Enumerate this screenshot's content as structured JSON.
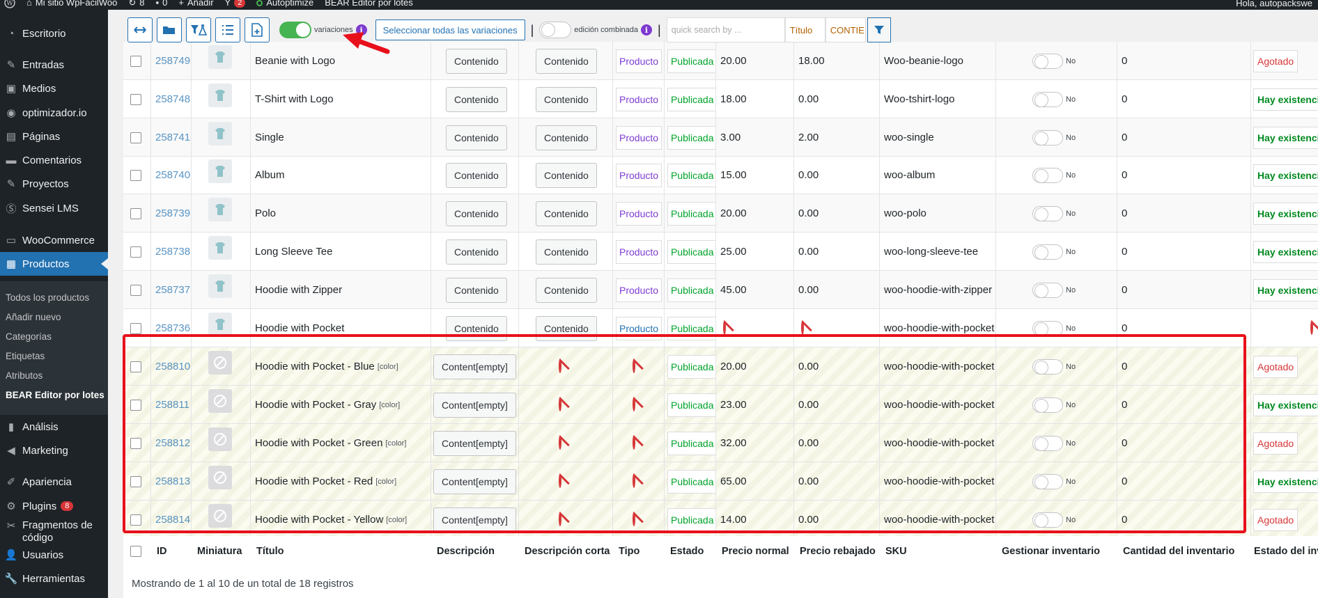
{
  "adminbar": {
    "site_name": "Mi sitio WpFácilWoo",
    "updates": "8",
    "comments": "0",
    "new_label": "Añadir",
    "yoast_badge": "2",
    "autoptimize": "Autoptimize",
    "bear": "BEAR Editor por lotes",
    "greeting": "Hola, autopackswe"
  },
  "sidebar": {
    "items": [
      {
        "label": "Escritorio",
        "icon": "dashboard-icon"
      },
      {
        "label": "Entradas",
        "icon": "pin-icon"
      },
      {
        "label": "Medios",
        "icon": "media-icon"
      },
      {
        "label": "optimizador.io",
        "icon": "optimizer-icon"
      },
      {
        "label": "Páginas",
        "icon": "pages-icon"
      },
      {
        "label": "Comentarios",
        "icon": "comment-icon"
      },
      {
        "label": "Proyectos",
        "icon": "pin-icon"
      },
      {
        "label": "Sensei LMS",
        "icon": "sensei-icon"
      },
      {
        "label": "WooCommerce",
        "icon": "woo-icon"
      },
      {
        "label": "Productos",
        "icon": "archive-icon"
      },
      {
        "label": "Análisis",
        "icon": "chart-icon"
      },
      {
        "label": "Marketing",
        "icon": "megaphone-icon"
      },
      {
        "label": "Apariencia",
        "icon": "brush-icon"
      },
      {
        "label": "Plugins",
        "icon": "plugin-icon",
        "badge": "8"
      },
      {
        "label": "Fragmentos de",
        "label2": "código",
        "icon": "scissors-icon"
      },
      {
        "label": "Usuarios",
        "icon": "users-icon"
      },
      {
        "label": "Herramientas",
        "icon": "wrench-icon"
      }
    ],
    "submenu": [
      "Todos los productos",
      "Añadir nuevo",
      "Categorías",
      "Etiquetas",
      "Atributos",
      "BEAR Editor por lotes"
    ]
  },
  "toolbar": {
    "variations_label": "variaciones",
    "select_all_variations": "Seleccionar todas las variaciones",
    "combined_edit_label": "edición combinada",
    "search_placeholder": "quick search by ...",
    "field_title": "Título",
    "field_content": "CONTIE"
  },
  "rows": [
    {
      "id": "258749",
      "title": "Beanie with Logo",
      "desc": "Contenido",
      "short": "Contenido",
      "type": "Producto",
      "status": "Publicada",
      "regular": "20.00",
      "sale": "18.00",
      "sku": "Woo-beanie-logo",
      "manage": "No",
      "qty": "0",
      "stock": "Agotado",
      "stock_class": "out"
    },
    {
      "id": "258748",
      "title": "T-Shirt with Logo",
      "desc": "Contenido",
      "short": "Contenido",
      "type": "Producto",
      "status": "Publicada",
      "regular": "18.00",
      "sale": "0.00",
      "sku": "Woo-tshirt-logo",
      "manage": "No",
      "qty": "0",
      "stock": "Hay existencias",
      "stock_class": "in"
    },
    {
      "id": "258741",
      "title": "Single",
      "desc": "Contenido",
      "short": "Contenido",
      "type": "Producto",
      "status": "Publicada",
      "regular": "3.00",
      "sale": "2.00",
      "sku": "woo-single",
      "manage": "No",
      "qty": "0",
      "stock": "Hay existencias",
      "stock_class": "in"
    },
    {
      "id": "258740",
      "title": "Album",
      "desc": "Contenido",
      "short": "Contenido",
      "type": "Producto",
      "status": "Publicada",
      "regular": "15.00",
      "sale": "0.00",
      "sku": "woo-album",
      "manage": "No",
      "qty": "0",
      "stock": "Hay existencias",
      "stock_class": "in"
    },
    {
      "id": "258739",
      "title": "Polo",
      "desc": "Contenido",
      "short": "Contenido",
      "type": "Producto",
      "status": "Publicada",
      "regular": "20.00",
      "sale": "0.00",
      "sku": "woo-polo",
      "manage": "No",
      "qty": "0",
      "stock": "Hay existencias",
      "stock_class": "in"
    },
    {
      "id": "258738",
      "title": "Long Sleeve Tee",
      "desc": "Contenido",
      "short": "Contenido",
      "type": "Producto",
      "status": "Publicada",
      "regular": "25.00",
      "sale": "0.00",
      "sku": "woo-long-sleeve-tee",
      "manage": "No",
      "qty": "0",
      "stock": "Hay existencias",
      "stock_class": "in"
    },
    {
      "id": "258737",
      "title": "Hoodie with Zipper",
      "desc": "Contenido",
      "short": "Contenido",
      "type": "Producto",
      "status": "Publicada",
      "regular": "45.00",
      "sale": "0.00",
      "sku": "woo-hoodie-with-zipper",
      "manage": "No",
      "qty": "0",
      "stock": "Hay existencias",
      "stock_class": "in"
    },
    {
      "id": "258736",
      "title": "Hoodie with Pocket",
      "desc": "Contenido",
      "short": "Contenido",
      "type": "Producto",
      "status": "Publicada",
      "regular": "",
      "sale": "",
      "sku": "woo-hoodie-with-pocket",
      "manage": "No",
      "qty": "0",
      "stock": "",
      "stock_class": "ban"
    }
  ],
  "variations": [
    {
      "id": "258810",
      "title": "Hoodie with Pocket - Blue",
      "tag": "[color]",
      "desc": "Content[empty]",
      "status": "Publicada",
      "regular": "20.00",
      "sale": "0.00",
      "sku": "woo-hoodie-with-pocket",
      "manage": "No",
      "qty": "0",
      "stock": "Agotado",
      "stock_class": "out"
    },
    {
      "id": "258811",
      "title": "Hoodie with Pocket - Gray",
      "tag": "[color]",
      "desc": "Content[empty]",
      "status": "Publicada",
      "regular": "23.00",
      "sale": "0.00",
      "sku": "woo-hoodie-with-pocket",
      "manage": "No",
      "qty": "0",
      "stock": "Hay existencias",
      "stock_class": "in"
    },
    {
      "id": "258812",
      "title": "Hoodie with Pocket - Green",
      "tag": "[color]",
      "desc": "Content[empty]",
      "status": "Publicada",
      "regular": "32.00",
      "sale": "0.00",
      "sku": "woo-hoodie-with-pocket",
      "manage": "No",
      "qty": "0",
      "stock": "Agotado",
      "stock_class": "out"
    },
    {
      "id": "258813",
      "title": "Hoodie with Pocket - Red",
      "tag": "[color]",
      "desc": "Content[empty]",
      "status": "Publicada",
      "regular": "65.00",
      "sale": "0.00",
      "sku": "woo-hoodie-with-pocket",
      "manage": "No",
      "qty": "0",
      "stock": "Hay existencias",
      "stock_class": "in"
    },
    {
      "id": "258814",
      "title": "Hoodie with Pocket - Yellow",
      "tag": "[color]",
      "desc": "Content[empty]",
      "status": "Publicada",
      "regular": "14.00",
      "sale": "0.00",
      "sku": "woo-hoodie-with-pocket",
      "manage": "No",
      "qty": "0",
      "stock": "Agotado",
      "stock_class": "out"
    }
  ],
  "columns": [
    "ID",
    "Miniatura",
    "Título",
    "Descripción",
    "Descripción corta",
    "Tipo",
    "Estado",
    "Precio normal",
    "Precio rebajado",
    "SKU",
    "Gestionar inventario",
    "Cantidad del inventario",
    "Estado del inventario"
  ],
  "footer": {
    "info": "Mostrando de 1 al 10 de un total de 18 registros"
  },
  "colors": {
    "accent": "#2271b1",
    "highlight": "#e8101b",
    "in_stock": "#008a20",
    "out_of_stock": "#d63638"
  }
}
